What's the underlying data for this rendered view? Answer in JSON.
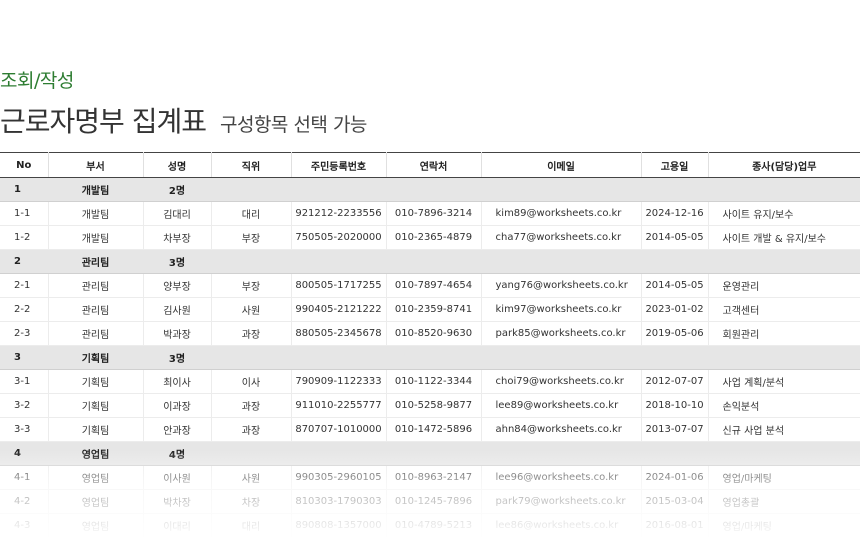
{
  "breadcrumb": "조회/작성",
  "title": "근로자명부 집계표",
  "subtitle": "구성항목 선택 가능",
  "columns": [
    "No",
    "부서",
    "성명",
    "직위",
    "주민등록번호",
    "연락처",
    "이메일",
    "고용일",
    "종사(담당)업무"
  ],
  "groups": [
    {
      "no": "1",
      "dept": "개발팀",
      "count": "2명",
      "rows": [
        [
          "1-1",
          "개발팀",
          "김대리",
          "대리",
          "921212-2233556",
          "010-7896-3214",
          "kim89@worksheets.co.kr",
          "2024-12-16",
          "사이트 유지/보수"
        ],
        [
          "1-2",
          "개발팀",
          "차부장",
          "부장",
          "750505-2020000",
          "010-2365-4879",
          "cha77@worksheets.co.kr",
          "2014-05-05",
          "사이트 개발 & 유지/보수"
        ]
      ]
    },
    {
      "no": "2",
      "dept": "관리팀",
      "count": "3명",
      "rows": [
        [
          "2-1",
          "관리팀",
          "양부장",
          "부장",
          "800505-1717255",
          "010-7897-4654",
          "yang76@worksheets.co.kr",
          "2014-05-05",
          "운영관리"
        ],
        [
          "2-2",
          "관리팀",
          "김사원",
          "사원",
          "990405-2121222",
          "010-2359-8741",
          "kim97@worksheets.co.kr",
          "2023-01-02",
          "고객센터"
        ],
        [
          "2-3",
          "관리팀",
          "박과장",
          "과장",
          "880505-2345678",
          "010-8520-9630",
          "park85@worksheets.co.kr",
          "2019-05-06",
          "회원관리"
        ]
      ]
    },
    {
      "no": "3",
      "dept": "기획팀",
      "count": "3명",
      "rows": [
        [
          "3-1",
          "기획팀",
          "최이사",
          "이사",
          "790909-1122333",
          "010-1122-3344",
          "choi79@worksheets.co.kr",
          "2012-07-07",
          "사업 계획/분석"
        ],
        [
          "3-2",
          "기획팀",
          "이과장",
          "과장",
          "911010-2255777",
          "010-5258-9877",
          "lee89@worksheets.co.kr",
          "2018-10-10",
          "손익분석"
        ],
        [
          "3-3",
          "기획팀",
          "안과장",
          "과장",
          "870707-1010000",
          "010-1472-5896",
          "ahn84@worksheets.co.kr",
          "2013-07-07",
          "신규 사업 분석"
        ]
      ]
    },
    {
      "no": "4",
      "dept": "영업팀",
      "count": "4명",
      "rows": [
        [
          "4-1",
          "영업팀",
          "이사원",
          "사원",
          "990305-2960105",
          "010-8963-2147",
          "lee96@worksheets.co.kr",
          "2024-01-06",
          "영업/마케팅"
        ],
        [
          "4-2",
          "영업팀",
          "박차장",
          "차장",
          "810303-1790303",
          "010-1245-7896",
          "park79@worksheets.co.kr",
          "2015-03-04",
          "영업총괄"
        ],
        [
          "4-3",
          "영업팀",
          "이대리",
          "대리",
          "890808-1357000",
          "010-4789-5213",
          "lee86@worksheets.co.kr",
          "2016-08-01",
          "영업/마케팅"
        ]
      ]
    }
  ]
}
